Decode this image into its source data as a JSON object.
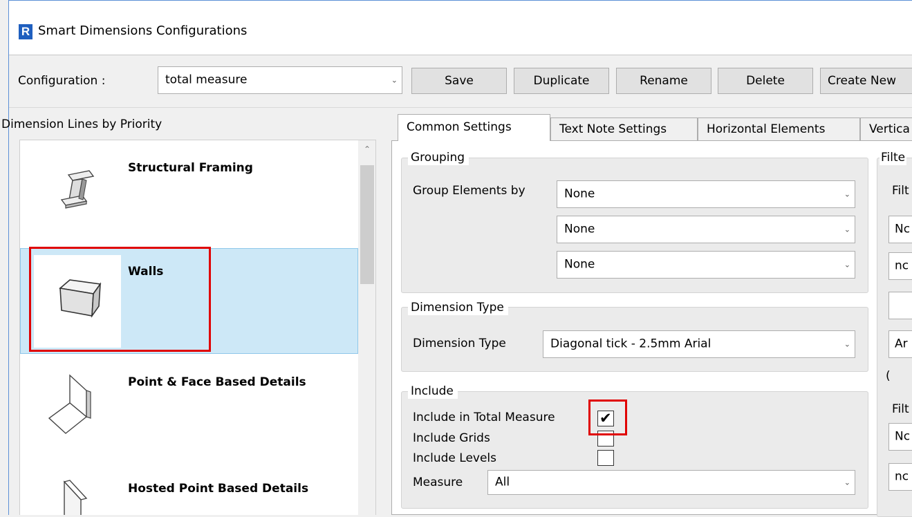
{
  "window": {
    "title": "Smart Dimensions Configurations",
    "app_icon_letter": "R"
  },
  "config": {
    "label": "Configuration  :",
    "value": "total measure",
    "buttons": {
      "save": "Save",
      "duplicate": "Duplicate",
      "rename": "Rename",
      "delete": "Delete",
      "create_new": "Create New"
    }
  },
  "left_panel": {
    "title": "Dimension Lines by Priority",
    "items": [
      {
        "label": "Structural Framing"
      },
      {
        "label": "Walls",
        "selected": true
      },
      {
        "label": "Point & Face Based Details"
      },
      {
        "label": "Hosted Point Based Details"
      }
    ]
  },
  "tabs": [
    {
      "label": "Common Settings",
      "active": true
    },
    {
      "label": "Text Note Settings"
    },
    {
      "label": "Horizontal Elements"
    },
    {
      "label": "Vertica"
    }
  ],
  "grouping": {
    "title": "Grouping",
    "label": "Group Elements by",
    "values": [
      "None",
      "None",
      "None"
    ]
  },
  "dimension_type": {
    "title": "Dimension Type",
    "label": "Dimension Type",
    "value": "Diagonal tick - 2.5mm Arial"
  },
  "include": {
    "title": "Include",
    "total_measure_label": "Include in Total Measure",
    "total_measure_checked": true,
    "grids_label": "Include Grids",
    "grids_checked": false,
    "levels_label": "Include Levels",
    "levels_checked": false,
    "measure_label": "Measure",
    "measure_value": "All"
  },
  "right_clipped": {
    "filter_title": "Filte",
    "filter_label_1": "Filt",
    "combo_1": "Nc",
    "combo_2": "nc",
    "combo_3": "",
    "combo_4": "Ar",
    "paren": "(",
    "filter_label_2": "Filt",
    "combo_5": "Nc",
    "combo_6": "nc"
  },
  "colors": {
    "selection": "#cde8f7",
    "highlight": "#e00000",
    "titlebar": "#ffffff"
  }
}
